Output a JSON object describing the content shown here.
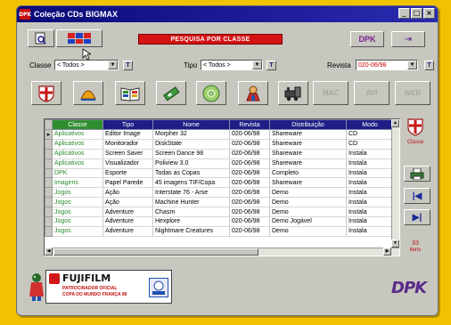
{
  "window": {
    "app_icon_text": "DPK",
    "title": "Coleção CDs BIGMAX",
    "buttons": [
      "_",
      "□",
      "×"
    ]
  },
  "toolbar": {
    "banner": "PESQUISA POR CLASSE",
    "dpk_button": "DPK"
  },
  "filters": {
    "classe_label": "Classe",
    "classe_value": "< Todos >",
    "tipo_label": "Tipo",
    "tipo_value": "< Todos >",
    "revista_label": "Revista",
    "revista_value": "020-06/98",
    "t_label": "T"
  },
  "categories": {
    "disabled": [
      "MAC",
      "AVI",
      "WEB"
    ]
  },
  "grid": {
    "columns": [
      "Classe",
      "Tipo",
      "Nome",
      "Revista",
      "Distribuição",
      "Modo"
    ],
    "rows": [
      [
        "Aplicativos",
        "Editor Image",
        "Morpher 32",
        "020-06/98",
        "Shareware",
        "CD"
      ],
      [
        "Aplicativos",
        "Monitorador",
        "DiskState",
        "020-06/98",
        "Shareware",
        "CD"
      ],
      [
        "Aplicativos",
        "Screen Saver",
        "Screen Dance 98",
        "020-06/98",
        "Shareware",
        "Instala"
      ],
      [
        "Aplicativos",
        "Visualizador",
        "Poliview 3.0",
        "020-06/98",
        "Shareware",
        "Instala"
      ],
      [
        "DPK",
        "Esporte",
        "Todas as Copas",
        "020-06/98",
        "Completo",
        "Instala"
      ],
      [
        "Imagens",
        "Papel Parede",
        "45 imagens TIF/Copa",
        "020-06/98",
        "Shareware",
        "Instala"
      ],
      [
        "Jogos",
        "Ação",
        "Interstate 76 - Arse",
        "020-06/98",
        "Demo",
        "Instala"
      ],
      [
        "Jogos",
        "Ação",
        "Machine Hunter",
        "020-06/98",
        "Demo",
        "Instala"
      ],
      [
        "Jogos",
        "Adventure",
        "Chasm",
        "020-06/98",
        "Demo",
        "Instala"
      ],
      [
        "Jogos",
        "Adventure",
        "Hexplore",
        "020-06/98",
        "Demo Jogável",
        "Instala"
      ],
      [
        "Jogos",
        "Adventure",
        "Nightmare Creatures",
        "020-06/98",
        "Demo",
        "Instala"
      ]
    ]
  },
  "side": {
    "classe_label": "Classe",
    "count_number": "33",
    "count_label": "itens"
  },
  "sponsor": {
    "brand": "FUJIFILM",
    "line1": "PATROCINADOR OFICIAL",
    "line2": "COPA DO MUNDO FRANÇA 98"
  },
  "brand_logo": "DPK",
  "colors": {
    "background": "#f2c200",
    "titlebar": "#0a0a7a",
    "banner": "#d41414",
    "grid_header": "#1e1e86",
    "class_text": "#2a8a2a"
  }
}
